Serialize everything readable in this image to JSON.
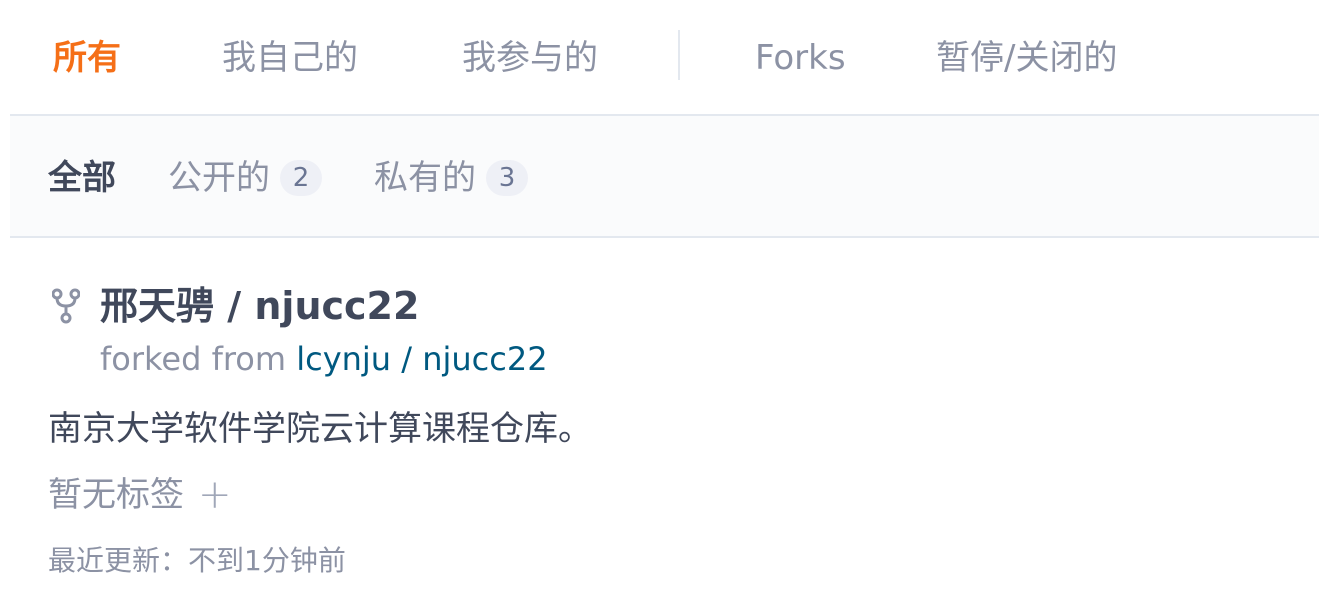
{
  "top_tabs": [
    {
      "label": "所有",
      "active": true
    },
    {
      "label": "我自己的",
      "active": false
    },
    {
      "label": "我参与的",
      "active": false
    },
    {
      "label": "Forks",
      "active": false
    },
    {
      "label": "暂停/关闭的",
      "active": false
    }
  ],
  "filters": [
    {
      "label": "全部",
      "active": true
    },
    {
      "label": "公开的",
      "count": "2",
      "active": false
    },
    {
      "label": "私有的",
      "count": "3",
      "active": false
    }
  ],
  "repo": {
    "icon": "fork-icon",
    "owner": "邢天骋",
    "separator": " / ",
    "name": "njucc22",
    "forked_prefix": "forked from ",
    "source_owner": "lcynju",
    "source_separator": " / ",
    "source_name": "njucc22",
    "description": "南京大学软件学院云计算课程仓库。",
    "tags_text": "暂无标签",
    "add_tag_icon": "plus-icon",
    "updated": "最近更新：不到1分钟前"
  },
  "colors": {
    "accent": "#f56f17",
    "link": "#005980",
    "text": "#40485b",
    "muted": "#8c92a4"
  }
}
